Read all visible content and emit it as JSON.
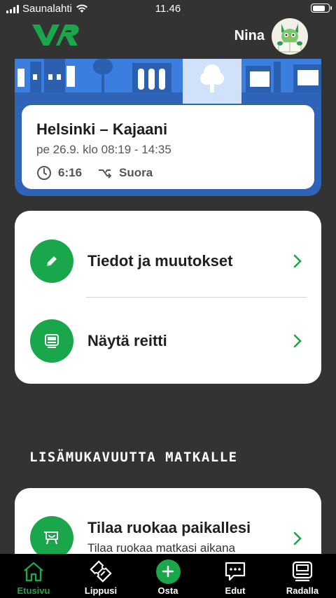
{
  "status_bar": {
    "carrier": "Saunalahti",
    "time": "11.46"
  },
  "header": {
    "brand": "VR",
    "user_name": "Nina"
  },
  "trip": {
    "route": "Helsinki – Kajaani",
    "datetime": "pe 26.9. klo 08:19 - 14:35",
    "duration": "6:16",
    "connection": "Suora"
  },
  "actions": [
    {
      "label": "Tiedot ja muutokset",
      "icon": "pencil-icon"
    },
    {
      "label": "Näytä reitti",
      "icon": "train-icon"
    }
  ],
  "section": {
    "title": "LISÄMUKAVUUTTA MATKALLE"
  },
  "food": {
    "title": "Tilaa ruokaa paikallesi",
    "subtitle": "Tilaa ruokaa matkasi aikana",
    "icon": "food-tray-icon"
  },
  "tabs": [
    {
      "label": "Etusivu",
      "icon": "home-icon",
      "active": true
    },
    {
      "label": "Lippusi",
      "icon": "ticket-icon",
      "active": false
    },
    {
      "label": "Osta",
      "icon": "plus-icon",
      "active": false
    },
    {
      "label": "Edut",
      "icon": "chat-bubble-icon",
      "active": false
    },
    {
      "label": "Radalla",
      "icon": "train-icon",
      "active": false
    }
  ],
  "colors": {
    "background": "#333333",
    "accent_green": "#1aa64a",
    "trip_blue": "#2e63b8",
    "tabbar": "#000000"
  }
}
